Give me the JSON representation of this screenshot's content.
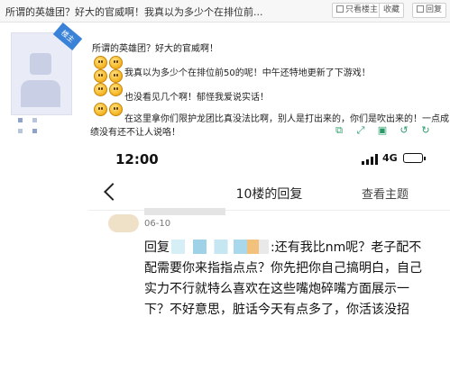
{
  "topbar": {
    "title": "所谓的英雄团？好大的官威啊！我真以为多少个在排位前...",
    "buttons": [
      "只看楼主",
      "收藏",
      "回复"
    ]
  },
  "author": {
    "badge": "楼主"
  },
  "post": {
    "lines": [
      "所谓的英雄团？好大的官威啊！",
      "我真以为多少个在排位前50的呢！中午还特地更新了下游戏！",
      "也没看见几个啊！郁怪我爱说实话！",
      "在这里拿你们限护龙团比真没法比啊，别人是打出来的，你们是吹出来的！一点成",
      "绩没有还不让人说咯！"
    ]
  },
  "phone": {
    "status": {
      "time": "12:00",
      "network": "4G"
    },
    "nav": {
      "title": "10楼的回复",
      "action": "查看主题"
    },
    "reply": {
      "date": "06-10",
      "prefix": "回复",
      "text": ":还有我比nm呢？老子配不配需要你来指指点点？你先把你自己搞明白，自己实力不行就特么喜欢在这些嘴炮碎嘴方面展示一下？不好意思，脏话今天有点多了，你活该没招"
    }
  }
}
